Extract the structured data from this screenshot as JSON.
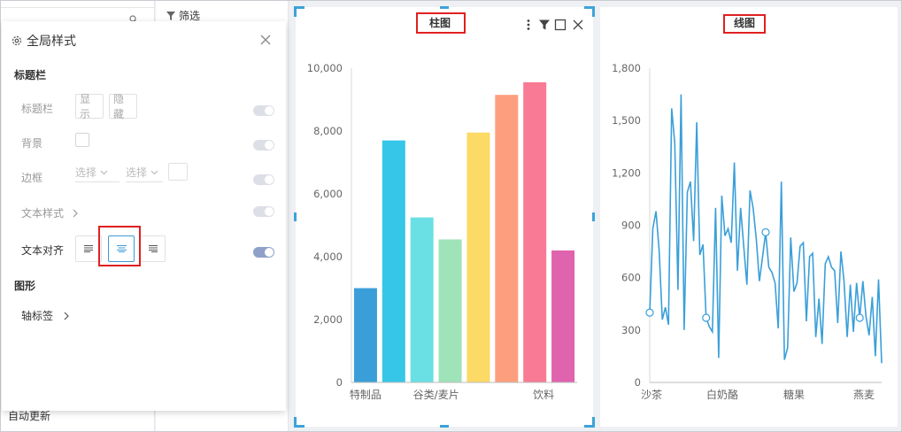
{
  "left_panel": {
    "auto_update": "自动更新"
  },
  "mid_panel": {
    "filter_label": "筛选"
  },
  "popup": {
    "title": "全局样式",
    "section_title_bar": "标题栏",
    "row_title_bar": "标题栏",
    "show_label": "显示",
    "hide_label": "隐藏",
    "row_background": "背景",
    "row_border": "边框",
    "select_placeholder_1": "选择",
    "select_placeholder_2": "选择",
    "row_text_style": "文本样式",
    "row_text_align": "文本对齐",
    "section_shape": "图形",
    "row_axis_label": "轴标签"
  },
  "bar_card": {
    "title": "柱图"
  },
  "line_card": {
    "title": "线图"
  },
  "colors": {
    "accent": "#3da3d8",
    "highlight": "#e02020"
  },
  "chart_data": [
    {
      "type": "bar",
      "title": "柱图",
      "categories": [
        "特制品",
        "",
        "谷类/麦片",
        "",
        "",
        "",
        "饮料",
        ""
      ],
      "values": [
        3000,
        7700,
        5250,
        4550,
        7950,
        9150,
        9550,
        4200
      ],
      "colors": [
        "#3a9fd9",
        "#35c6e8",
        "#6ae0e4",
        "#9fe3b8",
        "#fdd966",
        "#fd9f7e",
        "#f87a94",
        "#e063ae"
      ],
      "ylim": [
        0,
        10000
      ],
      "yticks": [
        "0",
        "2,000",
        "4,000",
        "6,000",
        "8,000",
        "10,000"
      ]
    },
    {
      "type": "line",
      "title": "线图",
      "xtick_labels": [
        "沙茶",
        "白奶酪",
        "糖果",
        "燕麦"
      ],
      "values": [
        400,
        880,
        980,
        760,
        360,
        430,
        330,
        1570,
        1370,
        530,
        1650,
        300,
        1090,
        1150,
        810,
        1490,
        730,
        790,
        370,
        320,
        290,
        1000,
        140,
        1070,
        840,
        880,
        800,
        1260,
        640,
        1000,
        780,
        560,
        1100,
        1000,
        820,
        580,
        720,
        860,
        660,
        630,
        570,
        310,
        1150,
        130,
        200,
        830,
        520,
        570,
        780,
        800,
        350,
        720,
        740,
        260,
        480,
        220,
        680,
        720,
        660,
        640,
        340,
        750,
        580,
        260,
        560,
        290,
        570,
        370,
        580,
        380,
        270,
        490,
        150,
        590,
        110
      ],
      "markers": [
        0,
        18,
        37,
        67
      ],
      "ylim": [
        0,
        1800
      ],
      "yticks": [
        "0",
        "300",
        "600",
        "900",
        "1,200",
        "1,500",
        "1,800"
      ],
      "color": "#3a9fd9"
    }
  ]
}
